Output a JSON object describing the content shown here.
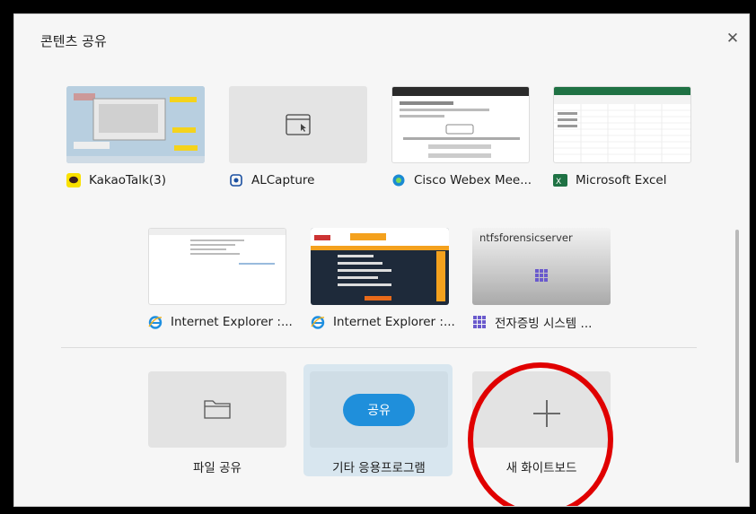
{
  "dialog": {
    "title": "콘텐츠 공유",
    "close_icon": "close-icon"
  },
  "windows": [
    {
      "name": "KakaoTalk(3)",
      "icon": "kakaotalk-icon"
    },
    {
      "name": "ALCapture",
      "icon": "alcapture-icon"
    },
    {
      "name": "Cisco Webex Mee...",
      "icon": "webex-icon"
    },
    {
      "name": "Microsoft Excel",
      "icon": "excel-icon"
    },
    {
      "name": "Internet Explorer :...",
      "icon": "ie-icon"
    },
    {
      "name": "Internet Explorer :...",
      "icon": "ie-icon"
    },
    {
      "name": "전자증빙 시스템 ...",
      "icon": "grid-app-icon",
      "thumb_title": "ntfsforensicserver"
    }
  ],
  "actions": {
    "file_share": {
      "label": "파일 공유",
      "icon": "folder-icon"
    },
    "other_apps": {
      "label": "기타 응용프로그램",
      "button": "공유"
    },
    "whiteboard": {
      "label": "새 화이트보드",
      "icon": "plus-icon"
    }
  },
  "colors": {
    "accent": "#1f8fdb",
    "highlight_circle": "#e00000",
    "selected_tile": "#d8e6ef"
  }
}
